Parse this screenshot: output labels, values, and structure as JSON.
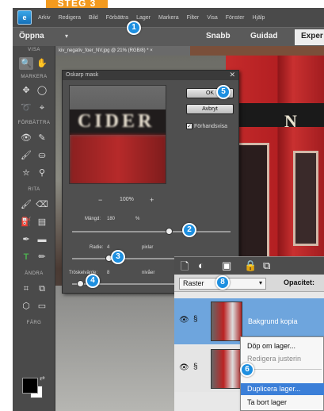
{
  "step_tab": {
    "label": "STEG 3"
  },
  "menu": {
    "items": [
      "Arkiv",
      "Redigera",
      "Bild",
      "Förbättra",
      "Lager",
      "Markera",
      "Filter",
      "Visa",
      "Fönster",
      "Hjälp"
    ]
  },
  "options_bar": {
    "open_label": "Öppna",
    "open_caret": "▾",
    "modes": {
      "quick": "Snabb",
      "guided": "Guidad",
      "expert": "Exper"
    }
  },
  "toolbox": {
    "sections": [
      "VISA",
      "MARKERA",
      "FÖRBÄTTRA",
      "RITA",
      "ÄNDRA",
      "FÄRG"
    ],
    "swap_glyph": "⇄",
    "tools": {
      "zoom": "🔍",
      "hand": "✋",
      "move": "✥",
      "marquee": "◯",
      "lasso": "➰",
      "quick-select": "⌖",
      "eye": "👁",
      "spot-heal": "✎",
      "smart-brush": "🖌",
      "stamp": "⛀",
      "eraser-sharpen": "⛥",
      "sponge": "⚲",
      "brush": "🖌",
      "eraser": "⌫",
      "bucket": "⛽",
      "gradient": "▤",
      "eyedropper": "✒",
      "shape": "▬",
      "type": "T",
      "pencil": "✏",
      "crop": "⌗",
      "recompose": "⧉",
      "redeye": "⬡",
      "straighten": "▭"
    }
  },
  "document": {
    "tab_title": "kiv_negativ_foer_NV.jpg @ 21% (RGB/8) *  ×"
  },
  "photo": {
    "sign_letter": "N"
  },
  "dialog": {
    "title": "Oskarp mask",
    "close_glyph": "✕",
    "preview_sign": "CIDER",
    "zoom_minus": "−",
    "zoom_value": "100%",
    "zoom_plus": "+",
    "ok_label": "OK",
    "cancel_label": "Avbryt",
    "preview_label": "Förhandsvisa",
    "preview_checked": "✓",
    "amount": {
      "label": "Mängd:",
      "value": "180",
      "unit": "%",
      "fraction": 0.62
    },
    "radius": {
      "label": "Radie:",
      "value": "4",
      "unit": "pixlar",
      "fraction": 0.22
    },
    "threshold": {
      "label": "Tröskelvärde:",
      "value": "8",
      "unit": "nivåer",
      "fraction": 0.03
    }
  },
  "layers_panel": {
    "toolbar_icons": [
      "🗋",
      "◐",
      "▣",
      "🔒",
      "⧉"
    ],
    "blend_mode": "Raster",
    "blend_caret": "▾",
    "opacity_label": "Opacitet:",
    "eye_glyph": "👁",
    "link_glyph": "§",
    "layers": [
      {
        "name": "Bakgrund kopia"
      },
      {
        "name": ""
      }
    ]
  },
  "context_menu": {
    "items": [
      "Döp om lager...",
      "Redigera justerin",
      "Duplicera lager...",
      "Ta bort lager"
    ]
  },
  "callouts": [
    "1",
    "2",
    "3",
    "4",
    "5",
    "6",
    "8"
  ],
  "colors": {
    "accent": "#1d8fe0",
    "step_tab": "#f39a1e",
    "selected_layer": "#6ea5dd",
    "menu_highlight": "#3b7fd8"
  }
}
